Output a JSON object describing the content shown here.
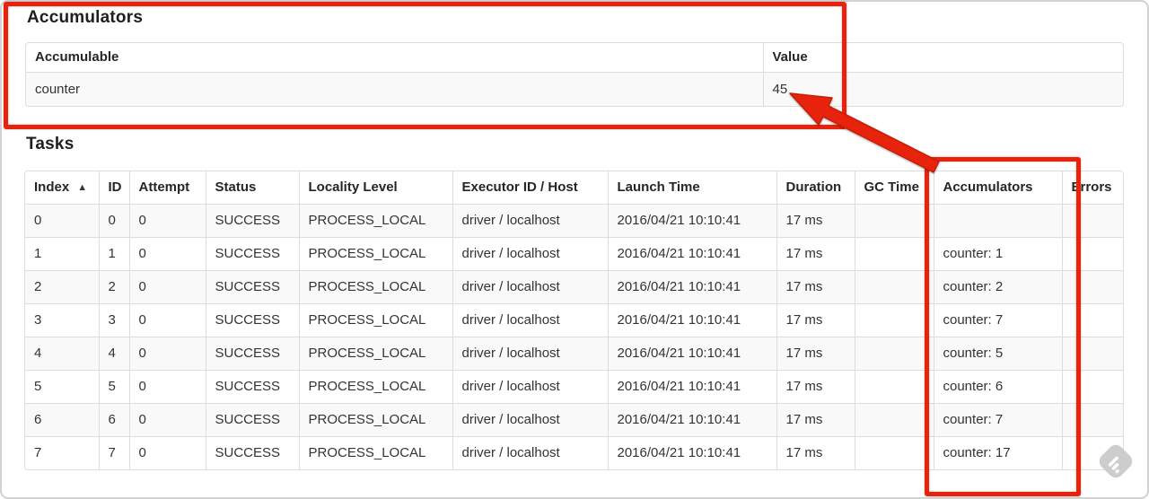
{
  "annotations": {
    "color": "#e8230d",
    "highlighted_regions": [
      "accumulators-summary-section",
      "tasks-accumulators-column"
    ],
    "arrow_points_to": "45"
  },
  "icons": {
    "sort_ascending": "▲",
    "watermark": "skitch-diamond-pencil"
  },
  "accumulators_section": {
    "title": "Accumulators",
    "table": {
      "headers": [
        "Accumulable",
        "Value"
      ],
      "rows": [
        [
          "counter",
          "45"
        ]
      ]
    }
  },
  "tasks_section": {
    "title": "Tasks",
    "table": {
      "headers": [
        "Index",
        "ID",
        "Attempt",
        "Status",
        "Locality Level",
        "Executor ID / Host",
        "Launch Time",
        "Duration",
        "GC Time",
        "Accumulators",
        "Errors"
      ],
      "sorted_column": 0,
      "sort_indicator": "▲",
      "rows": [
        [
          "0",
          "0",
          "0",
          "SUCCESS",
          "PROCESS_LOCAL",
          "driver / localhost",
          "2016/04/21 10:10:41",
          "17 ms",
          "",
          "",
          ""
        ],
        [
          "1",
          "1",
          "0",
          "SUCCESS",
          "PROCESS_LOCAL",
          "driver / localhost",
          "2016/04/21 10:10:41",
          "17 ms",
          "",
          "counter: 1",
          ""
        ],
        [
          "2",
          "2",
          "0",
          "SUCCESS",
          "PROCESS_LOCAL",
          "driver / localhost",
          "2016/04/21 10:10:41",
          "17 ms",
          "",
          "counter: 2",
          ""
        ],
        [
          "3",
          "3",
          "0",
          "SUCCESS",
          "PROCESS_LOCAL",
          "driver / localhost",
          "2016/04/21 10:10:41",
          "17 ms",
          "",
          "counter: 7",
          ""
        ],
        [
          "4",
          "4",
          "0",
          "SUCCESS",
          "PROCESS_LOCAL",
          "driver / localhost",
          "2016/04/21 10:10:41",
          "17 ms",
          "",
          "counter: 5",
          ""
        ],
        [
          "5",
          "5",
          "0",
          "SUCCESS",
          "PROCESS_LOCAL",
          "driver / localhost",
          "2016/04/21 10:10:41",
          "17 ms",
          "",
          "counter: 6",
          ""
        ],
        [
          "6",
          "6",
          "0",
          "SUCCESS",
          "PROCESS_LOCAL",
          "driver / localhost",
          "2016/04/21 10:10:41",
          "17 ms",
          "",
          "counter: 7",
          ""
        ],
        [
          "7",
          "7",
          "0",
          "SUCCESS",
          "PROCESS_LOCAL",
          "driver / localhost",
          "2016/04/21 10:10:41",
          "17 ms",
          "",
          "counter: 17",
          ""
        ]
      ]
    }
  }
}
